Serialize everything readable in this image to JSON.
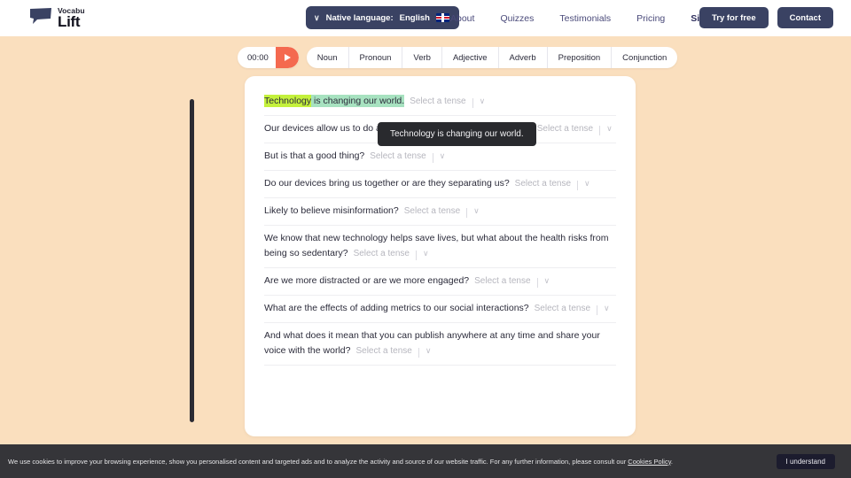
{
  "header": {
    "logo": {
      "top": "Vocabu",
      "bottom": "Lift",
      "icon": "speech-bubble-icon"
    },
    "language_selector": {
      "chevron": "∨",
      "label": "Native language:",
      "value": "English",
      "flag": "uk-flag-icon"
    },
    "nav": [
      {
        "label": "About",
        "active": false
      },
      {
        "label": "Quizzes",
        "active": false
      },
      {
        "label": "Testimonials",
        "active": false
      },
      {
        "label": "Pricing",
        "active": false
      },
      {
        "label": "Sign In",
        "active": true
      }
    ],
    "buttons": [
      {
        "label": "Try for free"
      },
      {
        "label": "Contact"
      }
    ],
    "accent_navy": "#3a4263"
  },
  "toolbar": {
    "timer": "00:00",
    "play_icon": "play-icon",
    "play_color": "#f4694f",
    "pos_buttons": [
      {
        "label": "Noun"
      },
      {
        "label": "Pronoun"
      },
      {
        "label": "Verb"
      },
      {
        "label": "Adjective"
      },
      {
        "label": "Adverb"
      },
      {
        "label": "Preposition"
      },
      {
        "label": "Conjunction"
      }
    ]
  },
  "tense_control": {
    "placeholder": "Select a tense",
    "chevron": "∨"
  },
  "sentences": [
    {
      "highlight_word": "Technology",
      "highlight_rest": " is changing our world.",
      "text": "Technology is changing our world.",
      "highlighted": true,
      "highlight_word_color": "#c4f13c",
      "highlight_rest_color": "#a7e2c0"
    },
    {
      "text": "Our devices allow us to do amazing things every day of our lives.",
      "highlighted": false
    },
    {
      "text": "But is that a good thing?",
      "highlighted": false
    },
    {
      "text": "Do our devices bring us together or are they separating us?",
      "highlighted": false
    },
    {
      "text": "Likely to believe misinformation?",
      "highlighted": false
    },
    {
      "text": "We know that new technology helps save lives, but what about the health risks from being so sedentary?",
      "highlighted": false
    },
    {
      "text": "Are we more distracted or are we more engaged?",
      "highlighted": false
    },
    {
      "text": "What are the effects of adding metrics to our social interactions?",
      "highlighted": false
    },
    {
      "text": "And what does it mean that you can publish anywhere at any time and share your voice with the world?",
      "highlighted": false
    }
  ],
  "tooltip": {
    "text": "Technology is changing our world."
  },
  "cookie_banner": {
    "text_before": "We use cookies to improve your browsing experience, show you personalised content and targeted ads and to analyze the activity and source of our website traffic. For any further information, please consult our ",
    "link": "Cookies Policy",
    "text_after": ".",
    "button": "I understand"
  },
  "colors": {
    "page_background": "#fadfbe",
    "card_background": "#ffffff",
    "tooltip_background": "#292a2e",
    "cookie_background": "#353539"
  }
}
